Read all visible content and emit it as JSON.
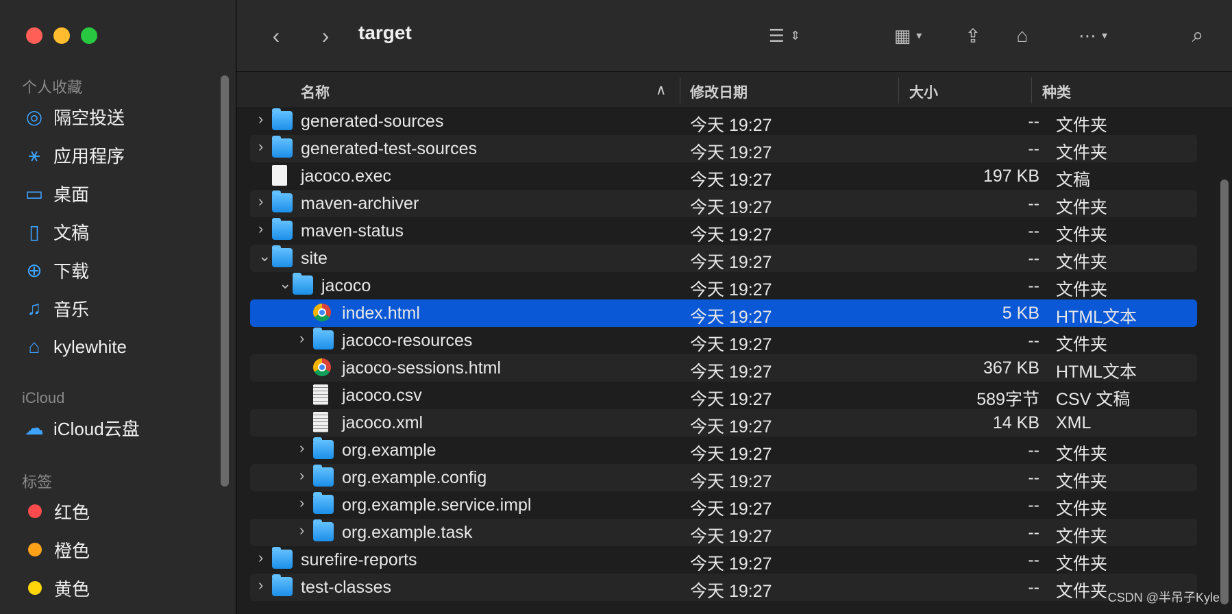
{
  "window": {
    "title": "target"
  },
  "sidebar": {
    "sections": [
      {
        "title": "个人收藏"
      },
      {
        "title": "iCloud"
      },
      {
        "title": "标签"
      }
    ],
    "favorites": [
      {
        "label": "隔空投送",
        "icon": "airdrop-icon"
      },
      {
        "label": "应用程序",
        "icon": "applications-icon"
      },
      {
        "label": "桌面",
        "icon": "desktop-icon"
      },
      {
        "label": "文稿",
        "icon": "documents-icon"
      },
      {
        "label": "下载",
        "icon": "downloads-icon"
      },
      {
        "label": "音乐",
        "icon": "music-icon"
      },
      {
        "label": "kylewhite",
        "icon": "home-icon"
      }
    ],
    "icloud": [
      {
        "label": "iCloud云盘",
        "icon": "cloud-icon"
      }
    ],
    "tags": [
      {
        "label": "红色",
        "color": "#ff4b4b"
      },
      {
        "label": "橙色",
        "color": "#ffa21a"
      },
      {
        "label": "黄色",
        "color": "#ffd60a"
      }
    ]
  },
  "columns": {
    "name": "名称",
    "modified": "修改日期",
    "size": "大小",
    "kind": "种类"
  },
  "files": [
    {
      "name": "generated-sources",
      "modified": "今天 19:27",
      "size": "--",
      "kind": "文件夹",
      "type": "folder",
      "depth": 0,
      "expanded": false
    },
    {
      "name": "generated-test-sources",
      "modified": "今天 19:27",
      "size": "--",
      "kind": "文件夹",
      "type": "folder",
      "depth": 0,
      "expanded": false
    },
    {
      "name": "jacoco.exec",
      "modified": "今天 19:27",
      "size": "197 KB",
      "kind": "文稿",
      "type": "file",
      "depth": 0
    },
    {
      "name": "maven-archiver",
      "modified": "今天 19:27",
      "size": "--",
      "kind": "文件夹",
      "type": "folder",
      "depth": 0,
      "expanded": false
    },
    {
      "name": "maven-status",
      "modified": "今天 19:27",
      "size": "--",
      "kind": "文件夹",
      "type": "folder",
      "depth": 0,
      "expanded": false
    },
    {
      "name": "site",
      "modified": "今天 19:27",
      "size": "--",
      "kind": "文件夹",
      "type": "folder",
      "depth": 0,
      "expanded": true
    },
    {
      "name": "jacoco",
      "modified": "今天 19:27",
      "size": "--",
      "kind": "文件夹",
      "type": "folder",
      "depth": 1,
      "expanded": true
    },
    {
      "name": "index.html",
      "modified": "今天 19:27",
      "size": "5 KB",
      "kind": "HTML文本",
      "type": "html",
      "depth": 2,
      "selected": true
    },
    {
      "name": "jacoco-resources",
      "modified": "今天 19:27",
      "size": "--",
      "kind": "文件夹",
      "type": "folder",
      "depth": 2,
      "expanded": false
    },
    {
      "name": "jacoco-sessions.html",
      "modified": "今天 19:27",
      "size": "367 KB",
      "kind": "HTML文本",
      "type": "html",
      "depth": 2
    },
    {
      "name": "jacoco.csv",
      "modified": "今天 19:27",
      "size": "589字节",
      "kind": "CSV 文稿",
      "type": "text",
      "depth": 2
    },
    {
      "name": "jacoco.xml",
      "modified": "今天 19:27",
      "size": "14 KB",
      "kind": "XML",
      "type": "text",
      "depth": 2
    },
    {
      "name": "org.example",
      "modified": "今天 19:27",
      "size": "--",
      "kind": "文件夹",
      "type": "folder",
      "depth": 2,
      "expanded": false
    },
    {
      "name": "org.example.config",
      "modified": "今天 19:27",
      "size": "--",
      "kind": "文件夹",
      "type": "folder",
      "depth": 2,
      "expanded": false
    },
    {
      "name": "org.example.service.impl",
      "modified": "今天 19:27",
      "size": "--",
      "kind": "文件夹",
      "type": "folder",
      "depth": 2,
      "expanded": false
    },
    {
      "name": "org.example.task",
      "modified": "今天 19:27",
      "size": "--",
      "kind": "文件夹",
      "type": "folder",
      "depth": 2,
      "expanded": false
    },
    {
      "name": "surefire-reports",
      "modified": "今天 19:27",
      "size": "--",
      "kind": "文件夹",
      "type": "folder",
      "depth": 0,
      "expanded": false
    },
    {
      "name": "test-classes",
      "modified": "今天 19:27",
      "size": "--",
      "kind": "文件夹",
      "type": "folder",
      "depth": 0,
      "expanded": false
    }
  ],
  "watermark": "CSDN @半吊子Kyle",
  "accent": "#0b58d6"
}
